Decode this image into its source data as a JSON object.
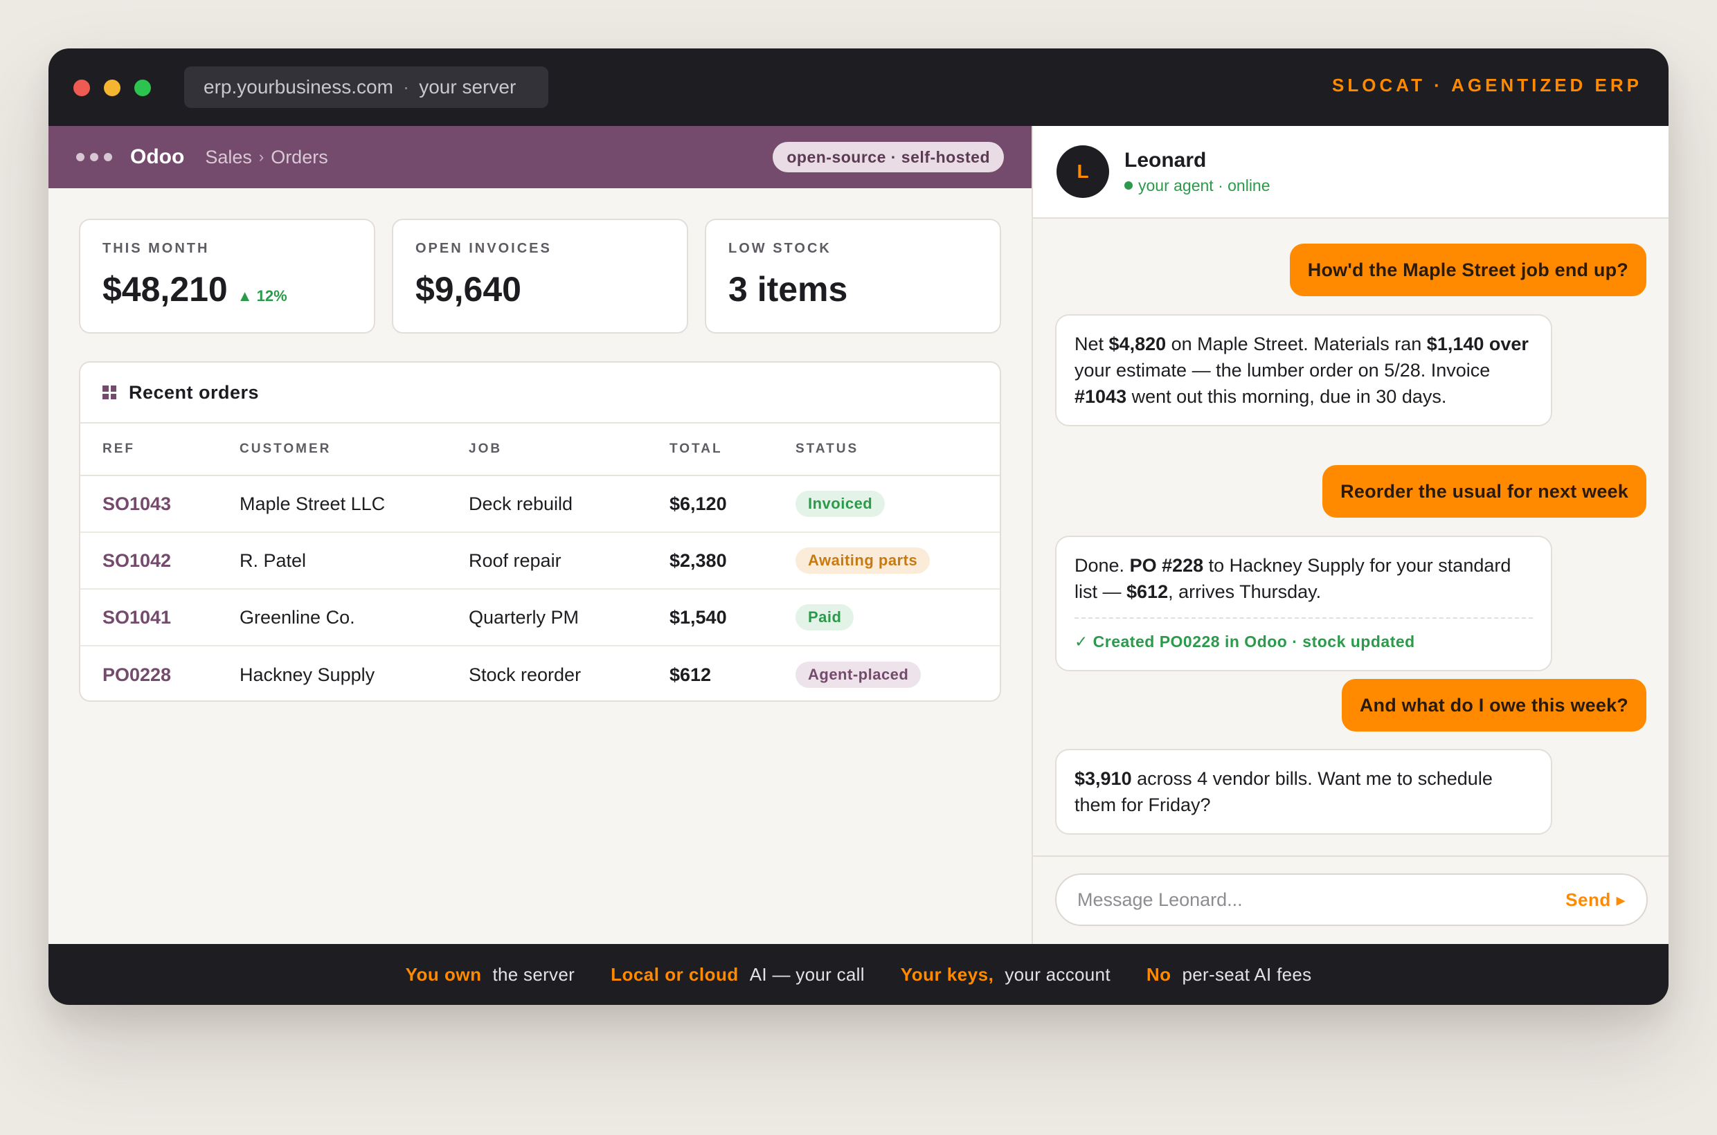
{
  "window": {
    "url": "erp.yourbusiness.com",
    "url_suffix": "your server",
    "url_sep": "·",
    "brand_tag": "SLOCAT · AGENTIZED ERP"
  },
  "app": {
    "name": "Odoo",
    "breadcrumb": [
      "Sales",
      "Orders"
    ],
    "breadcrumb_sep": "›",
    "badge": "open-source · self-hosted"
  },
  "kpis": [
    {
      "label": "THIS MONTH",
      "value": "$48,210",
      "delta": "▲ 12%"
    },
    {
      "label": "OPEN INVOICES",
      "value": "$9,640"
    },
    {
      "label": "LOW STOCK",
      "value": "3 items"
    }
  ],
  "orders": {
    "title": "Recent orders",
    "columns": [
      "REF",
      "CUSTOMER",
      "JOB",
      "TOTAL",
      "STATUS"
    ],
    "rows": [
      {
        "ref": "SO1043",
        "customer": "Maple Street LLC",
        "job": "Deck rebuild",
        "total": "$6,120",
        "status": "Invoiced"
      },
      {
        "ref": "SO1042",
        "customer": "R. Patel",
        "job": "Roof repair",
        "total": "$2,380",
        "status": "Awaiting parts"
      },
      {
        "ref": "SO1041",
        "customer": "Greenline Co.",
        "job": "Quarterly PM",
        "total": "$1,540",
        "status": "Paid"
      },
      {
        "ref": "PO0228",
        "customer": "Hackney Supply",
        "job": "Stock reorder",
        "total": "$612",
        "status": "Agent-placed"
      }
    ]
  },
  "agent": {
    "initial": "L",
    "name": "Leonard",
    "status": "your agent · online"
  },
  "messages": {
    "m1": "How'd the Maple Street job end up?",
    "m2": {
      "t1": "Net ",
      "b1": "$4,820",
      "t2": " on Maple Street. Materials ran ",
      "b2": "$1,140 over",
      "t3": " your estimate — the lumber order on 5/28. Invoice ",
      "b3": "#1043",
      "t4": " went out this morning, due in 30 days."
    },
    "m3": "Reorder the usual for next week",
    "m4": {
      "t1": "Done. ",
      "b1": "PO #228",
      "t2": " to Hackney Supply for your standard list — ",
      "b2": "$612",
      "t3": ", arrives Thursday.",
      "action": "✓ Created PO0228 in Odoo · stock updated"
    },
    "m5": "And what do I owe this week?",
    "m6": {
      "b1": "$3,910",
      "t1": " across 4 vendor bills. Want me to schedule them for Friday?"
    }
  },
  "composer": {
    "placeholder": "Message Leonard...",
    "send_label": "Send ▸"
  },
  "features": [
    {
      "highlight": "You own",
      "rest": "the server"
    },
    {
      "highlight": "Local or cloud",
      "rest": "AI — your call"
    },
    {
      "highlight": "Your keys,",
      "rest": "your account"
    },
    {
      "highlight": "No",
      "rest": "per-seat AI fees"
    }
  ],
  "colors": {
    "accent": "#ff8a00",
    "brand_purple": "#744b6c",
    "success": "#2b9a4a",
    "warning": "#c77a12",
    "dark": "#1e1d21"
  }
}
